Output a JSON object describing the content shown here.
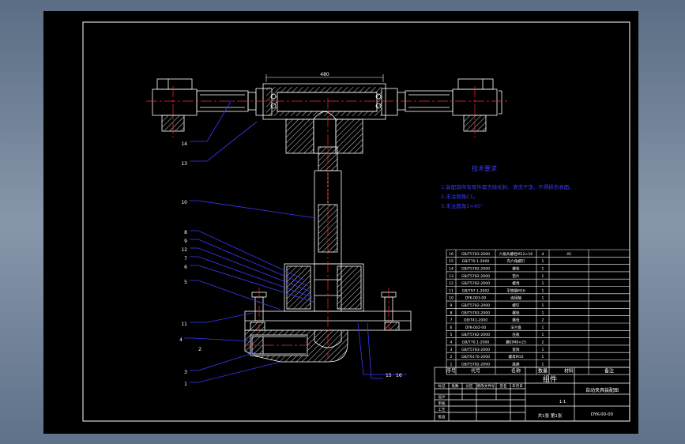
{
  "notes": {
    "title": "技术要求",
    "lines": [
      "1.装配前所有零件需去除毛刺、清洗干净，不得损伤表面。",
      "2.未注倒角C1。",
      "3.未注圆角1×45°"
    ]
  },
  "balloons": [
    "14",
    "13",
    "10",
    "8",
    "9",
    "12",
    "7",
    "6",
    "5",
    "11",
    "4",
    "3",
    "1",
    "2",
    "15",
    "16"
  ],
  "dimension": "480",
  "bom": {
    "rows": [
      [
        "16",
        "GB/T5783-2000",
        "六角头螺栓M12×16",
        "4",
        "45",
        ""
      ],
      [
        "15",
        "GB/T70.1-2000",
        "内六角螺钉",
        "1",
        "",
        ""
      ],
      [
        "14",
        "GB/T5782-2000",
        "螺栓",
        "1",
        "",
        ""
      ],
      [
        "13",
        "GB/T5782-2000",
        "垫片",
        "1",
        "",
        ""
      ],
      [
        "12",
        "GB/T5782-2000",
        "螺母",
        "1",
        "",
        ""
      ],
      [
        "11",
        "GB/T97.1-2002",
        "平垫圈M16",
        "1",
        "",
        ""
      ],
      [
        "10",
        "DYK-003-00",
        "连接轴",
        "1",
        "",
        ""
      ],
      [
        "9",
        "GB/T5782-2000",
        "螺钉",
        "1",
        "",
        ""
      ],
      [
        "8",
        "GB/T5783-2000",
        "螺栓",
        "1",
        "",
        ""
      ],
      [
        "7",
        "GB/T41-2000",
        "螺母",
        "2",
        "",
        ""
      ],
      [
        "6",
        "DYK-002-00",
        "法兰盘",
        "1",
        "",
        ""
      ],
      [
        "5",
        "GB/T5782-2000",
        "压板",
        "1",
        "",
        ""
      ],
      [
        "4",
        "GB/T70.1-2000",
        "螺钉M8×25",
        "2",
        "",
        ""
      ],
      [
        "3",
        "GB/T5783-2000",
        "套筒",
        "1",
        "",
        ""
      ],
      [
        "2",
        "GB/T6170-2000",
        "螺母M10",
        "1",
        "",
        ""
      ],
      [
        "1",
        "GB/T5782-2000",
        "底座",
        "1",
        "",
        ""
      ]
    ],
    "headers": [
      "序号",
      "代号",
      "名称",
      "数量",
      "材料",
      "备注"
    ]
  },
  "titleblock": {
    "assembly": "组件",
    "drawing_name": "自动夹具装配图",
    "code": "DYK-00-00",
    "scale": "1:1",
    "sheet": "共1张 第1张",
    "rev_labels": [
      "标记",
      "处数",
      "分区",
      "更改文件号",
      "签名",
      "年月日"
    ],
    "role_labels": [
      "设计",
      "审核",
      "工艺",
      "批准"
    ]
  },
  "colors": {
    "line": "#ffffff",
    "leader": "#3a3aff",
    "center": "#ff2a2a",
    "part": "#e8e8e8",
    "text_blue": "#3a3aff",
    "border": "#ffffff"
  }
}
